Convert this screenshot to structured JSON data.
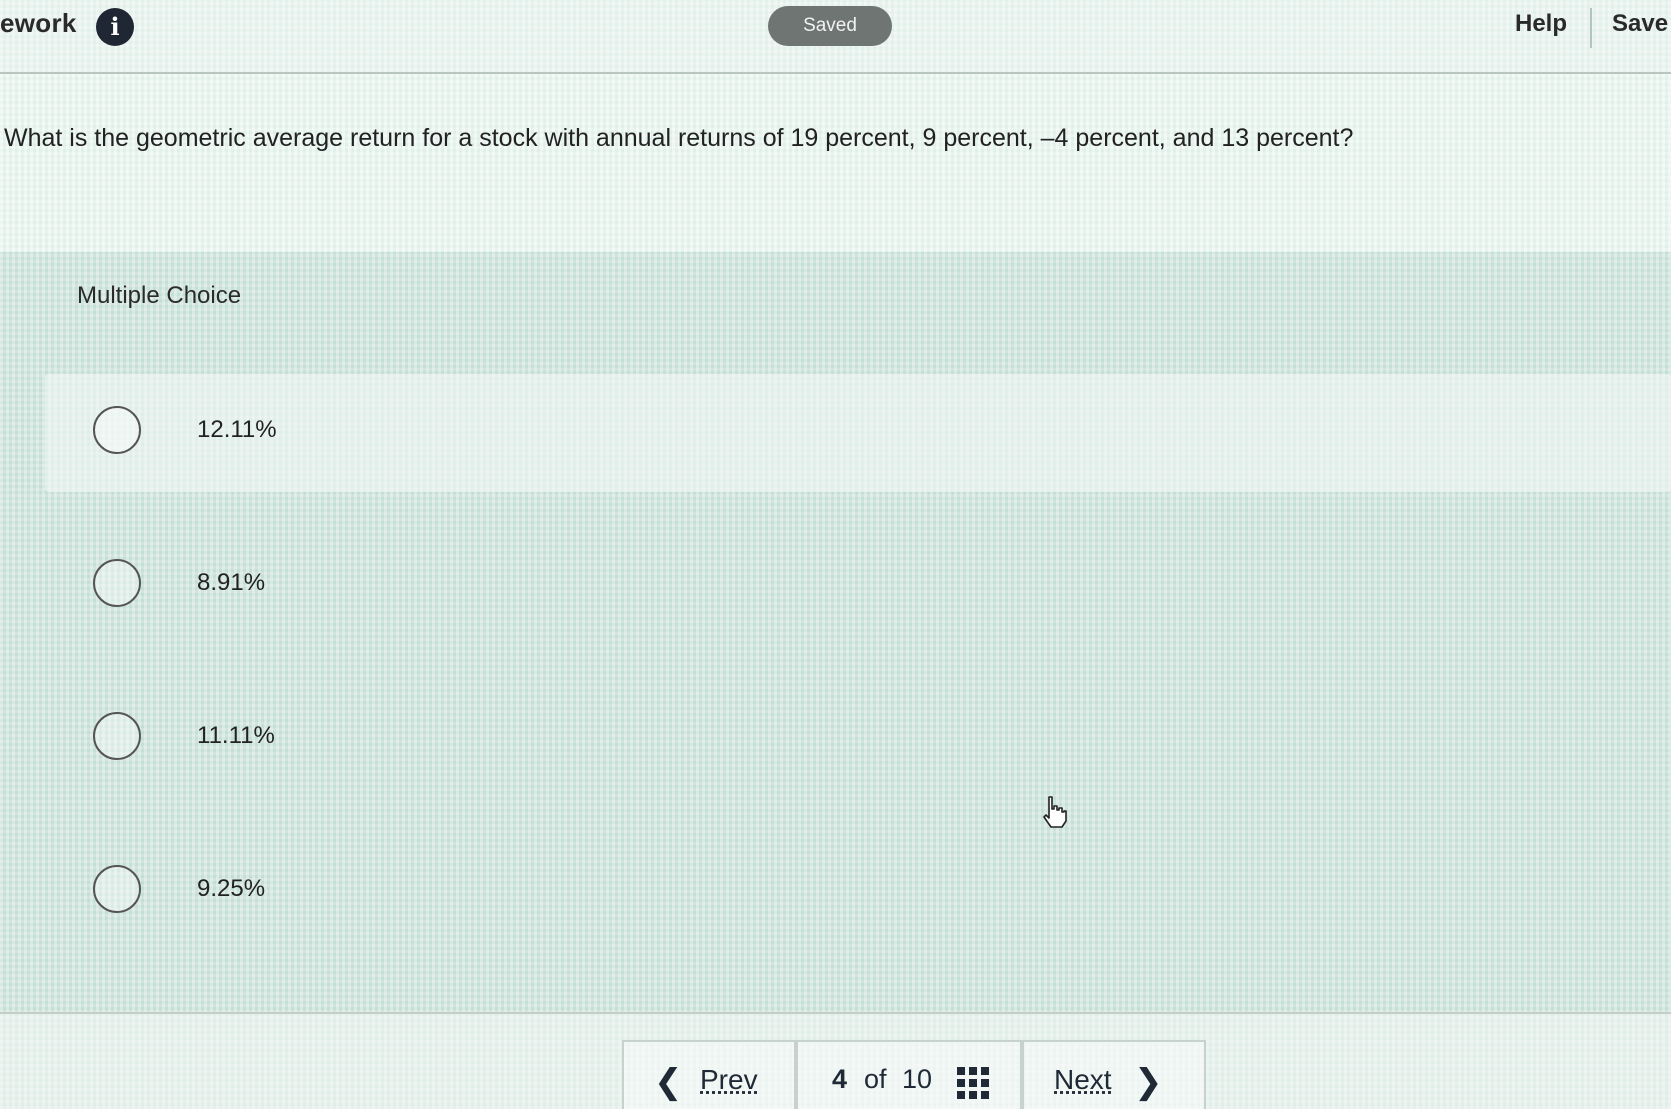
{
  "header": {
    "app_title": "ework",
    "info_icon": "info-icon",
    "status": "Saved",
    "help_label": "Help",
    "save_label": "Save"
  },
  "question": {
    "text": "What is the geometric average return for a stock with annual returns of 19 percent, 9 percent, –4 percent, and 13 percent?"
  },
  "answer_section": {
    "type_label": "Multiple Choice",
    "choices": [
      {
        "label": "12.11%",
        "selected": false
      },
      {
        "label": "8.91%",
        "selected": false
      },
      {
        "label": "11.11%",
        "selected": false
      },
      {
        "label": "9.25%",
        "selected": false
      }
    ]
  },
  "navigation": {
    "prev_label": "Prev",
    "next_label": "Next",
    "current_page": "4",
    "of_label": "of",
    "total_pages": "10",
    "prev_icon": "chevron-left-icon",
    "next_icon": "chevron-right-icon",
    "grid_icon": "grid-icon"
  },
  "colors": {
    "accent_dark": "#1f2a36",
    "saved_pill": "#6f7572"
  }
}
